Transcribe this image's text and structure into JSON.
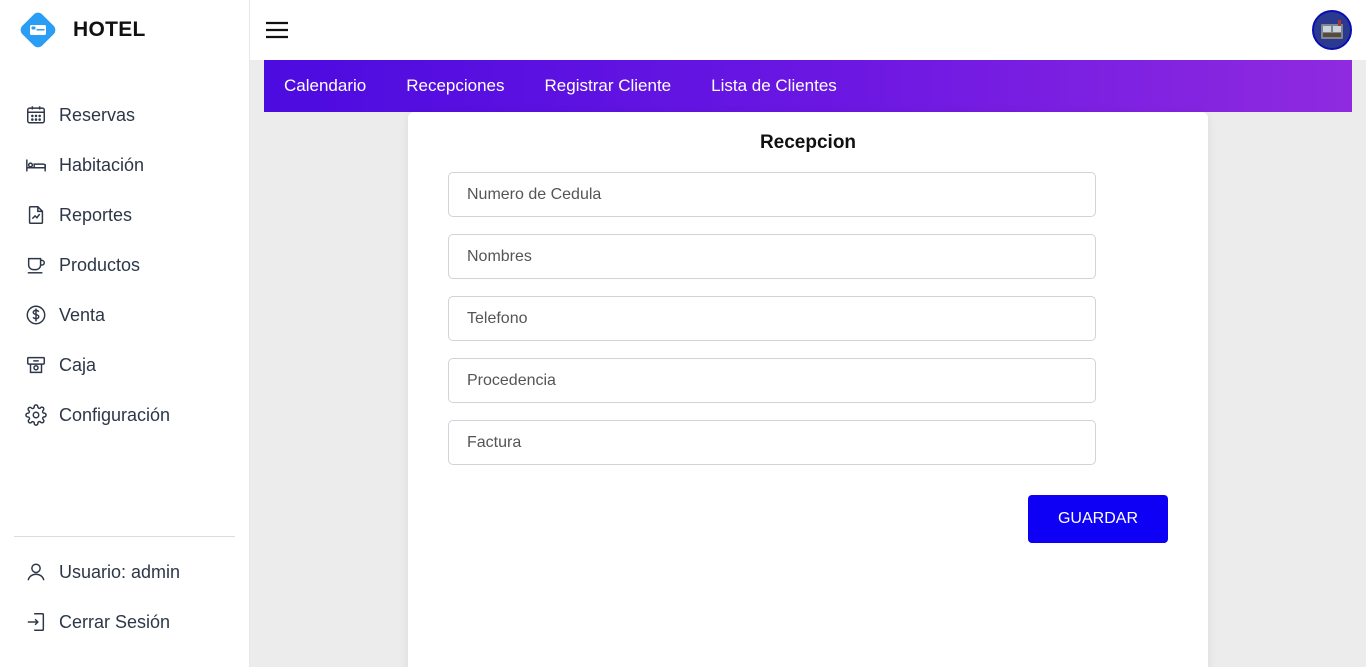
{
  "brand": {
    "name": "HOTEL",
    "icon": "hotel-bed-icon",
    "color": "#2a9df4"
  },
  "sidebar": {
    "items": [
      {
        "label": "Reservas",
        "icon": "calendar-icon"
      },
      {
        "label": "Habitación",
        "icon": "bed-icon"
      },
      {
        "label": "Reportes",
        "icon": "report-file-icon"
      },
      {
        "label": "Productos",
        "icon": "coffee-cup-icon"
      },
      {
        "label": "Venta",
        "icon": "dollar-circle-icon"
      },
      {
        "label": "Caja",
        "icon": "cash-register-icon"
      },
      {
        "label": "Configuración",
        "icon": "gear-icon"
      }
    ],
    "bottom": [
      {
        "label": "Usuario: admin",
        "icon": "user-icon"
      },
      {
        "label": "Cerrar Sesión",
        "icon": "logout-icon"
      }
    ]
  },
  "topbar": {
    "menu_icon": "hamburger-menu-icon",
    "avatar_icon": "user-avatar-icon"
  },
  "subnav": {
    "tabs": [
      "Calendario",
      "Recepciones",
      "Registrar Cliente",
      "Lista de Clientes"
    ],
    "gradient_start": "#4c0be0",
    "gradient_end": "#8f2ae0"
  },
  "form": {
    "title": "Recepcion",
    "fields": [
      {
        "placeholder": "Numero de Cedula",
        "value": ""
      },
      {
        "placeholder": "Nombres",
        "value": ""
      },
      {
        "placeholder": "Telefono",
        "value": ""
      },
      {
        "placeholder": "Procedencia",
        "value": ""
      },
      {
        "placeholder": "Factura",
        "value": ""
      }
    ],
    "save_label": "GUARDAR",
    "save_color": "#0d00f5"
  }
}
